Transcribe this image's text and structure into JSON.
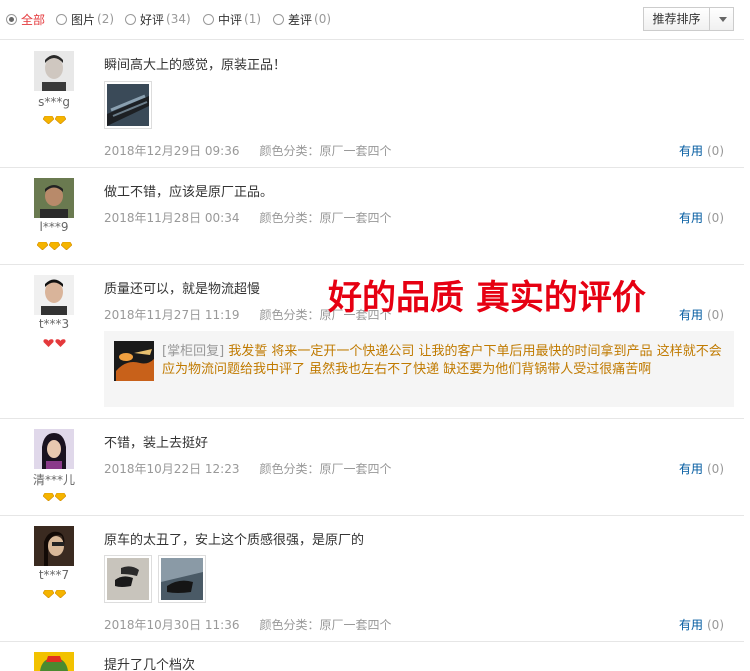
{
  "filters": [
    {
      "label": "全部",
      "count": "",
      "active": true
    },
    {
      "label": "图片",
      "count": "(2)",
      "active": false
    },
    {
      "label": "好评",
      "count": "(34)",
      "active": false
    },
    {
      "label": "中评",
      "count": "(1)",
      "active": false
    },
    {
      "label": "差评",
      "count": "(0)",
      "active": false
    }
  ],
  "sort": {
    "label": "推荐排序"
  },
  "overlay": "好的品质 真实的评价",
  "useful_label": "有用",
  "reviews": [
    {
      "user": "s***g",
      "content": "瞬间高大上的感觉，原装正品！",
      "date": "2018年12月29日 09:36",
      "spec": "颜色分类：原厂一套四个",
      "useful": "(0)"
    },
    {
      "user": "l***9",
      "content": "做工不错，应该是原厂正品。",
      "date": "2018年11月28日 00:34",
      "spec": "颜色分类：原厂一套四个",
      "useful": "(0)"
    },
    {
      "user": "t***3",
      "content": "质量还可以，就是物流超慢",
      "date": "2018年11月27日 11:19",
      "spec": "颜色分类：原厂一套四个",
      "useful": "(0)",
      "reply": {
        "tag": "[掌柜回复]",
        "text": "我发誓 将来一定开一个快递公司 让我的客户下单后用最快的时间拿到产品 这样就不会应为物流问题给我中评了 虽然我也左右不了快递 缺还要为他们背锅带人受过很痛苦啊"
      }
    },
    {
      "user": "清***儿",
      "content": "不错，装上去挺好",
      "date": "2018年10月22日 12:23",
      "spec": "颜色分类：原厂一套四个",
      "useful": "(0)"
    },
    {
      "user": "t***7",
      "content": "原车的太丑了，安上这个质感很强，是原厂的",
      "date": "2018年10月30日 11:36",
      "spec": "颜色分类：原厂一套四个",
      "useful": "(0)"
    },
    {
      "user": "",
      "content": "提升了几个档次",
      "date": "",
      "spec": "",
      "useful": ""
    }
  ]
}
